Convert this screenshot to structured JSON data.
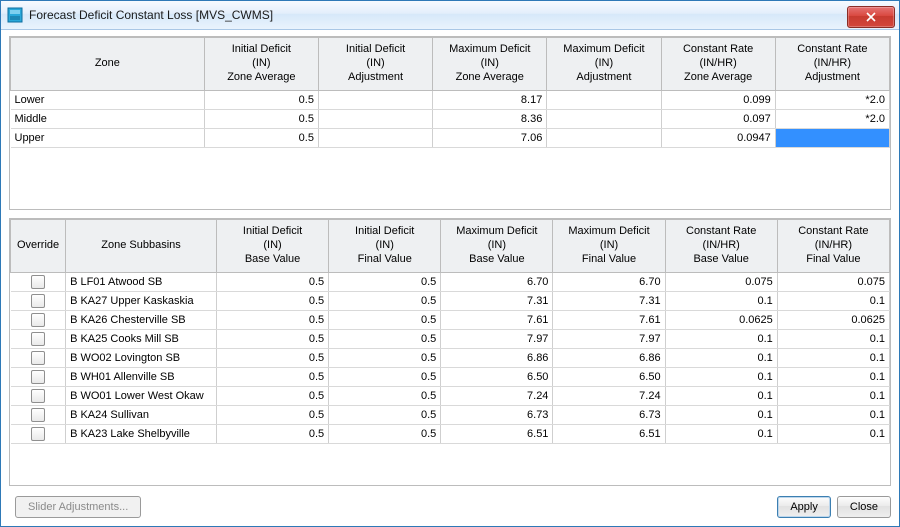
{
  "window": {
    "title": "Forecast Deficit Constant Loss [MVS_CWMS]"
  },
  "buttons": {
    "slider_adjustments": "Slider Adjustments...",
    "apply": "Apply",
    "close": "Close"
  },
  "zone_table": {
    "headers": {
      "zone": "Zone",
      "initial_deficit_avg": "Initial Deficit\n(IN)\nZone Average",
      "initial_deficit_adj": "Initial Deficit\n(IN)\nAdjustment",
      "max_deficit_avg": "Maximum Deficit\n(IN)\nZone Average",
      "max_deficit_adj": "Maximum Deficit\n(IN)\nAdjustment",
      "crate_avg": "Constant Rate\n(IN/HR)\nZone Average",
      "crate_adj": "Constant Rate\n(IN/HR)\nAdjustment"
    },
    "rows": [
      {
        "zone": "Lower",
        "id_avg": "0.5",
        "id_adj": "",
        "md_avg": "8.17",
        "md_adj": "",
        "cr_avg": "0.099",
        "cr_adj": "*2.0"
      },
      {
        "zone": "Middle",
        "id_avg": "0.5",
        "id_adj": "",
        "md_avg": "8.36",
        "md_adj": "",
        "cr_avg": "0.097",
        "cr_adj": "*2.0"
      },
      {
        "zone": "Upper",
        "id_avg": "0.5",
        "id_adj": "",
        "md_avg": "7.06",
        "md_adj": "",
        "cr_avg": "0.0947",
        "cr_adj": ""
      }
    ]
  },
  "subbasin_table": {
    "headers": {
      "override": "Override",
      "subbasin": "Zone Subbasins",
      "id_base": "Initial Deficit\n(IN)\nBase Value",
      "id_final": "Initial Deficit\n(IN)\nFinal Value",
      "md_base": "Maximum Deficit\n(IN)\nBase Value",
      "md_final": "Maximum Deficit\n(IN)\nFinal Value",
      "cr_base": "Constant Rate\n(IN/HR)\nBase Value",
      "cr_final": "Constant Rate\n(IN/HR)\nFinal Value"
    },
    "rows": [
      {
        "name": "B LF01 Atwood SB",
        "id_b": "0.5",
        "id_f": "0.5",
        "md_b": "6.70",
        "md_f": "6.70",
        "cr_b": "0.075",
        "cr_f": "0.075"
      },
      {
        "name": "B KA27 Upper Kaskaskia",
        "id_b": "0.5",
        "id_f": "0.5",
        "md_b": "7.31",
        "md_f": "7.31",
        "cr_b": "0.1",
        "cr_f": "0.1"
      },
      {
        "name": "B KA26 Chesterville SB",
        "id_b": "0.5",
        "id_f": "0.5",
        "md_b": "7.61",
        "md_f": "7.61",
        "cr_b": "0.0625",
        "cr_f": "0.0625"
      },
      {
        "name": "B KA25 Cooks Mill SB",
        "id_b": "0.5",
        "id_f": "0.5",
        "md_b": "7.97",
        "md_f": "7.97",
        "cr_b": "0.1",
        "cr_f": "0.1"
      },
      {
        "name": "B WO02 Lovington SB",
        "id_b": "0.5",
        "id_f": "0.5",
        "md_b": "6.86",
        "md_f": "6.86",
        "cr_b": "0.1",
        "cr_f": "0.1"
      },
      {
        "name": "B WH01 Allenville SB",
        "id_b": "0.5",
        "id_f": "0.5",
        "md_b": "6.50",
        "md_f": "6.50",
        "cr_b": "0.1",
        "cr_f": "0.1"
      },
      {
        "name": "B WO01 Lower West Okaw",
        "id_b": "0.5",
        "id_f": "0.5",
        "md_b": "7.24",
        "md_f": "7.24",
        "cr_b": "0.1",
        "cr_f": "0.1"
      },
      {
        "name": "B KA24 Sullivan",
        "id_b": "0.5",
        "id_f": "0.5",
        "md_b": "6.73",
        "md_f": "6.73",
        "cr_b": "0.1",
        "cr_f": "0.1"
      },
      {
        "name": "B KA23 Lake Shelbyville",
        "id_b": "0.5",
        "id_f": "0.5",
        "md_b": "6.51",
        "md_f": "6.51",
        "cr_b": "0.1",
        "cr_f": "0.1"
      }
    ]
  }
}
